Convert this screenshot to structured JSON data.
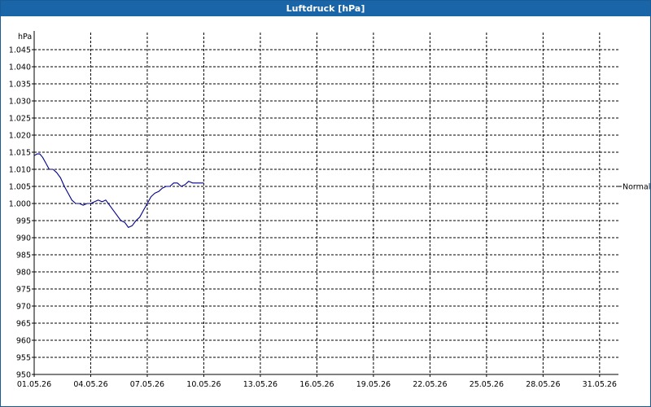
{
  "window": {
    "title": "Luftdruck [hPa]"
  },
  "chart_data": {
    "type": "line",
    "title": "Luftdruck [hPa]",
    "ylabel": "hPa",
    "xlabel": "",
    "ylim": [
      950,
      1050
    ],
    "y_ticks": [
      950,
      955,
      960,
      965,
      970,
      975,
      980,
      985,
      990,
      995,
      1000,
      1005,
      1010,
      1015,
      1020,
      1025,
      1030,
      1035,
      1040,
      1045
    ],
    "y_tick_labels": [
      "950",
      "955",
      "960",
      "965",
      "970",
      "975",
      "980",
      "985",
      "990",
      "995",
      "1.000",
      "1.005",
      "1.010",
      "1.015",
      "1.020",
      "1.025",
      "1.030",
      "1.035",
      "1.040",
      "1.045"
    ],
    "x_range_days": [
      1,
      32
    ],
    "x_ticks": [
      1,
      4,
      7,
      10,
      13,
      16,
      19,
      22,
      25,
      28,
      31
    ],
    "x_tick_labels": [
      "01.05.26",
      "04.05.26",
      "07.05.26",
      "10.05.26",
      "13.05.26",
      "16.05.26",
      "19.05.26",
      "22.05.26",
      "25.05.26",
      "28.05.26",
      "31.05.26"
    ],
    "grid": true,
    "reference_line": {
      "label": "Normal",
      "value": 1005
    },
    "series": [
      {
        "color": "#00008b",
        "x": [
          1.0,
          1.15,
          1.3,
          1.45,
          1.6,
          1.8,
          2.0,
          2.2,
          2.4,
          2.6,
          2.8,
          3.0,
          3.2,
          3.4,
          3.6,
          3.8,
          4.0,
          4.2,
          4.4,
          4.6,
          4.8,
          5.0,
          5.2,
          5.4,
          5.6,
          5.8,
          6.0,
          6.2,
          6.4,
          6.6,
          6.8,
          7.0,
          7.2,
          7.4,
          7.6,
          7.8,
          8.0,
          8.2,
          8.4,
          8.6,
          8.8,
          9.0,
          9.2,
          9.4,
          9.6,
          9.8,
          10.0
        ],
        "y": [
          1014,
          1014.5,
          1014.5,
          1013.5,
          1012,
          1010,
          1010,
          1009,
          1007.5,
          1005,
          1003,
          1001,
          1000,
          1000,
          999.5,
          1000,
          1000,
          1000.5,
          1001,
          1000.5,
          1001,
          999.5,
          998,
          996.5,
          995,
          994.5,
          993,
          993.5,
          995,
          996,
          998,
          1000,
          1002,
          1003,
          1003.5,
          1004.5,
          1005,
          1005,
          1006,
          1006,
          1005,
          1005.5,
          1006.5,
          1006,
          1006,
          1006,
          1006
        ]
      }
    ]
  }
}
